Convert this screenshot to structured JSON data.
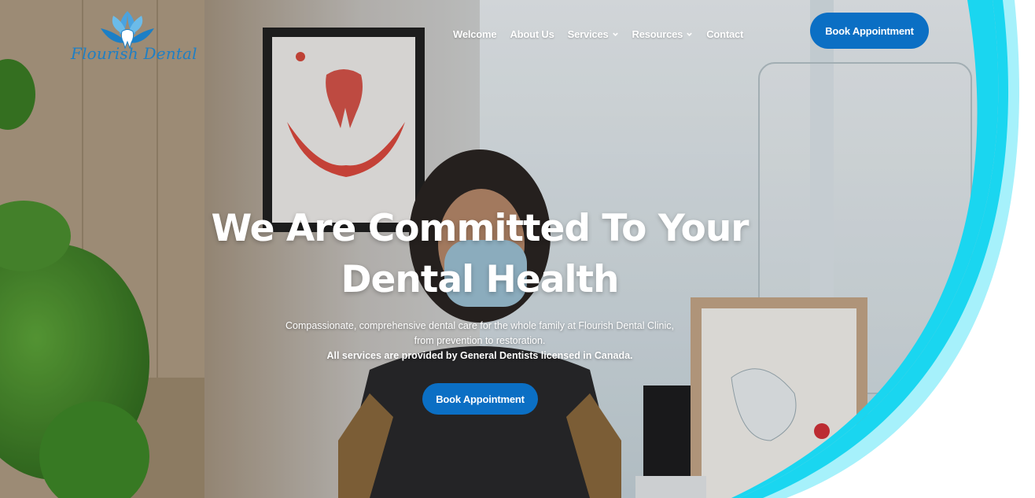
{
  "brand": {
    "name": "Flourish Dental",
    "logo_color": "#1f7fc4"
  },
  "nav": {
    "items": [
      {
        "label": "Welcome",
        "has_dropdown": false
      },
      {
        "label": "About Us",
        "has_dropdown": false
      },
      {
        "label": "Services",
        "has_dropdown": true
      },
      {
        "label": "Resources",
        "has_dropdown": true
      },
      {
        "label": "Contact",
        "has_dropdown": false
      }
    ],
    "cta_label": "Book Appointment"
  },
  "hero": {
    "headline_line1": "We Are Committed To Your",
    "headline_line2": "Dental Health",
    "subtext": "Compassionate, comprehensive dental care for the whole family at Flourish Dental Clinic, from prevention to restoration.",
    "subtext_bold": "All services are provided by General Dentists licensed in Canada.",
    "cta_label": "Book Appointment"
  },
  "colors": {
    "accent": "#0b6fc4",
    "curve_primary": "#1ad6f0",
    "curve_light": "#a6f1fb"
  }
}
